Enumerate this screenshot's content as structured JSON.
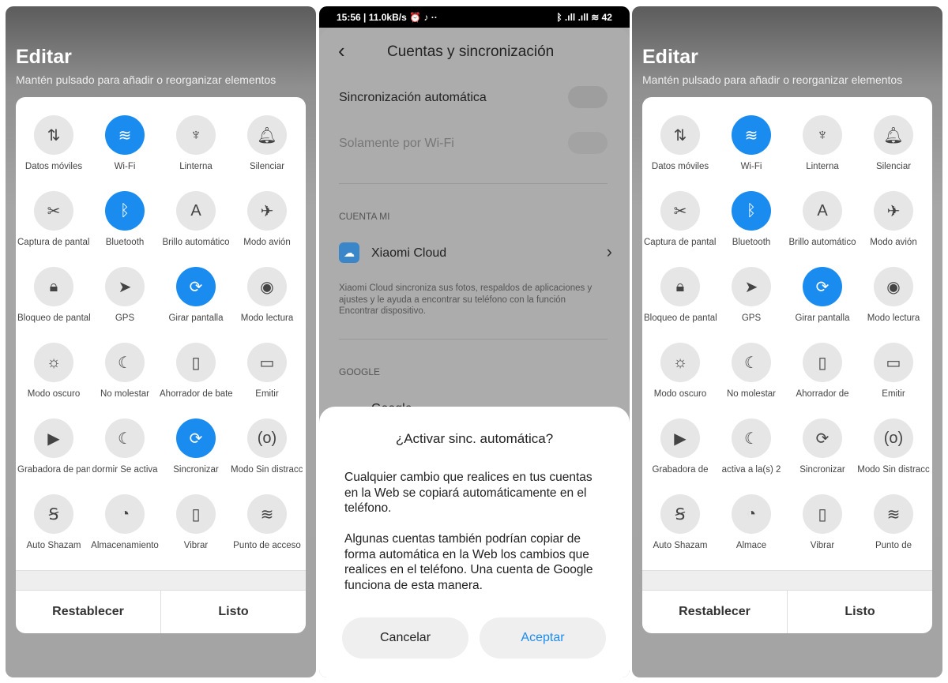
{
  "left": {
    "title": "Editar",
    "subtitle": "Mantén pulsado para añadir o reorganizar elementos",
    "tiles": [
      {
        "icon": "mobile-data-icon",
        "glyph": "⇅",
        "label": "Datos móviles",
        "on": false
      },
      {
        "icon": "wifi-icon",
        "glyph": "≋",
        "label": "Wi-Fi",
        "on": true
      },
      {
        "icon": "flashlight-icon",
        "glyph": "♆",
        "label": "Linterna",
        "on": false
      },
      {
        "icon": "bell-icon",
        "glyph": "🔔︎",
        "label": "Silenciar",
        "on": false
      },
      {
        "icon": "screenshot-icon",
        "glyph": "✂",
        "label": "Captura de pantalla",
        "on": false
      },
      {
        "icon": "bluetooth-icon",
        "glyph": "ᛒ",
        "label": "Bluetooth",
        "on": true
      },
      {
        "icon": "auto-brightness-icon",
        "glyph": "A",
        "label": "Brillo automático",
        "on": false
      },
      {
        "icon": "airplane-icon",
        "glyph": "✈",
        "label": "Modo avión",
        "on": false
      },
      {
        "icon": "lock-icon",
        "glyph": "🔒︎",
        "label": "Bloqueo de pantalla",
        "on": false
      },
      {
        "icon": "gps-icon",
        "glyph": "➤",
        "label": "GPS",
        "on": false
      },
      {
        "icon": "rotate-lock-icon",
        "glyph": "⟳",
        "label": "Girar pantalla",
        "on": true
      },
      {
        "icon": "eye-icon",
        "glyph": "◉",
        "label": "Modo lectura",
        "on": false
      },
      {
        "icon": "dark-mode-icon",
        "glyph": "☼",
        "label": "Modo oscuro",
        "on": false
      },
      {
        "icon": "moon-icon",
        "glyph": "☾",
        "label": "No molestar",
        "on": false
      },
      {
        "icon": "battery-saver-icon",
        "glyph": "▯",
        "label": "Ahorrador de batería",
        "on": false
      },
      {
        "icon": "cast-icon",
        "glyph": "▭",
        "label": "Emitir",
        "on": false
      },
      {
        "icon": "video-icon",
        "glyph": "▶",
        "label": "Grabadora de pantalla",
        "on": false
      },
      {
        "icon": "sleep-icon",
        "glyph": "☾",
        "label": "dormir Se activa",
        "on": false
      },
      {
        "icon": "sync-icon",
        "glyph": "⟳",
        "label": "Sincronizar",
        "on": true
      },
      {
        "icon": "focus-icon",
        "glyph": "(o)",
        "label": "Modo Sin distracciones",
        "on": false
      },
      {
        "icon": "shazam-icon",
        "glyph": "Ꞩ",
        "label": "Auto Shazam",
        "on": false
      },
      {
        "icon": "storage-icon",
        "glyph": "◔",
        "label": "Almacenamiento",
        "on": false
      },
      {
        "icon": "vibrate-icon",
        "glyph": "▯",
        "label": "Vibrar",
        "on": false
      },
      {
        "icon": "hotspot-icon",
        "glyph": "≋",
        "label": "Punto de acceso",
        "on": false
      }
    ],
    "reset": "Restablecer",
    "done": "Listo"
  },
  "right": {
    "title": "Editar",
    "subtitle": "Mantén pulsado para añadir o reorganizar elementos",
    "tiles": [
      {
        "icon": "mobile-data-icon",
        "glyph": "⇅",
        "label": "Datos móviles",
        "on": false
      },
      {
        "icon": "wifi-icon",
        "glyph": "≋",
        "label": "Wi-Fi",
        "on": true
      },
      {
        "icon": "flashlight-icon",
        "glyph": "♆",
        "label": "Linterna",
        "on": false
      },
      {
        "icon": "bell-icon",
        "glyph": "🔔︎",
        "label": "Silenciar",
        "on": false
      },
      {
        "icon": "screenshot-icon",
        "glyph": "✂",
        "label": "Captura de pantalla",
        "on": false
      },
      {
        "icon": "bluetooth-icon",
        "glyph": "ᛒ",
        "label": "Bluetooth",
        "on": true
      },
      {
        "icon": "auto-brightness-icon",
        "glyph": "A",
        "label": "Brillo automático",
        "on": false
      },
      {
        "icon": "airplane-icon",
        "glyph": "✈",
        "label": "Modo avión",
        "on": false
      },
      {
        "icon": "lock-icon",
        "glyph": "🔒︎",
        "label": "Bloqueo de pantalla",
        "on": false
      },
      {
        "icon": "gps-icon",
        "glyph": "➤",
        "label": "GPS",
        "on": false
      },
      {
        "icon": "rotate-lock-icon",
        "glyph": "⟳",
        "label": "Girar pantalla",
        "on": true
      },
      {
        "icon": "eye-icon",
        "glyph": "◉",
        "label": "Modo lectura",
        "on": false
      },
      {
        "icon": "dark-mode-icon",
        "glyph": "☼",
        "label": "Modo oscuro",
        "on": false
      },
      {
        "icon": "moon-icon",
        "glyph": "☾",
        "label": "No molestar",
        "on": false
      },
      {
        "icon": "battery-saver-icon",
        "glyph": "▯",
        "label": "Ahorrador de",
        "on": false
      },
      {
        "icon": "cast-icon",
        "glyph": "▭",
        "label": "Emitir",
        "on": false
      },
      {
        "icon": "video-icon",
        "glyph": "▶",
        "label": "Grabadora de",
        "on": false
      },
      {
        "icon": "sleep-icon",
        "glyph": "☾",
        "label": "activa a la(s) 2",
        "on": false
      },
      {
        "icon": "sync-icon",
        "glyph": "⟳",
        "label": "Sincronizar",
        "on": false
      },
      {
        "icon": "focus-icon",
        "glyph": "(o)",
        "label": "Modo Sin distracc",
        "on": false
      },
      {
        "icon": "shazam-icon",
        "glyph": "Ꞩ",
        "label": "Auto Shazam",
        "on": false
      },
      {
        "icon": "storage-icon",
        "glyph": "◔",
        "label": "Almace",
        "on": false
      },
      {
        "icon": "vibrate-icon",
        "glyph": "▯",
        "label": "Vibrar",
        "on": false
      },
      {
        "icon": "hotspot-icon",
        "glyph": "≋",
        "label": "Punto de",
        "on": false
      }
    ],
    "reset": "Restablecer",
    "done": "Listo"
  },
  "middle": {
    "status": {
      "left": "15:56 | 11.0kB/s ⏰ ♪ ··",
      "right": "ᛒ .ıll .ıll ≋ 42"
    },
    "title": "Cuentas y sincronización",
    "auto_sync": "Sincronización automática",
    "wifi_only": "Solamente por Wi-Fi",
    "section_mi": "CUENTA MI",
    "xiaomi_cloud": "Xiaomi Cloud",
    "cloud_desc": "Xiaomi Cloud sincroniza sus fotos, respaldos de aplicaciones y ajustes y le ayuda a encontrar su teléfono con la función Encontrar dispositivo.",
    "section_google": "GOOGLE",
    "google_item": "Google",
    "dialog": {
      "title": "¿Activar sinc. automática?",
      "p1": "Cualquier cambio que realices en tus cuentas en la Web se copiará automáticamente en el teléfono.",
      "p2": "Algunas cuentas también podrían copiar de forma automática en la Web los cambios que realices en el teléfono. Una cuenta de Google funciona de esta manera.",
      "cancel": "Cancelar",
      "accept": "Aceptar"
    },
    "accent": "#1a8cf0"
  }
}
